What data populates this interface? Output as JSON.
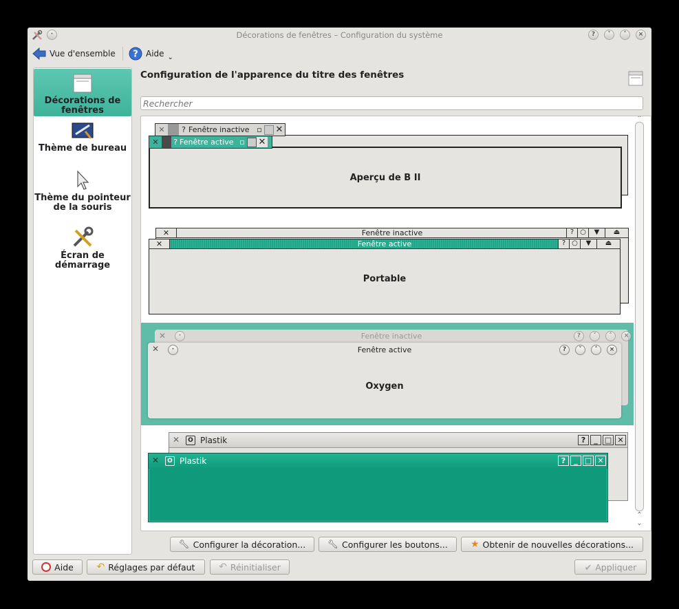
{
  "window": {
    "title": "Décorations de fenêtres – Configuration du système",
    "buttons": [
      "?",
      "v",
      "^",
      "x"
    ]
  },
  "toolbar": {
    "overview_label": "Vue d'ensemble",
    "help_label": "Aide"
  },
  "sidebar": {
    "items": [
      {
        "label": "Décorations de fenêtres",
        "icon": "window-decoration-icon",
        "active": true
      },
      {
        "label": "Thème de bureau",
        "icon": "desktop-theme-icon",
        "active": false
      },
      {
        "label": "Thème du pointeur de la souris",
        "icon": "mouse-pointer-icon",
        "active": false
      },
      {
        "label": "Écran de démarrage",
        "icon": "tools-icon",
        "active": false
      }
    ]
  },
  "main": {
    "title": "Configuration de l'apparence du titre des fenêtres",
    "search_placeholder": "Rechercher"
  },
  "decorations": [
    {
      "name": "Aperçu de B II",
      "inactive_title": "Fenêtre inactive",
      "active_title": "Fenêtre active",
      "selected": false
    },
    {
      "name": "Portable",
      "inactive_title": "Fenêtre inactive",
      "active_title": "Fenêtre active",
      "selected": false
    },
    {
      "name": "Oxygen",
      "inactive_title": "Fenêtre inactive",
      "active_title": "Fenêtre active",
      "selected": true
    },
    {
      "name": "Plastik",
      "inactive_title": "Plastik",
      "active_title": "Plastik",
      "selected": false
    }
  ],
  "action_buttons": {
    "configure_decoration": "Configurer la décoration...",
    "configure_buttons": "Configurer les boutons...",
    "get_new": "Obtenir de nouvelles décorations..."
  },
  "footer": {
    "help": "Aide",
    "defaults": "Réglages par défaut",
    "reset": "Réinitialiser",
    "apply": "Appliquer"
  },
  "colors": {
    "accent": "#3eb29a",
    "plastik_active": "#0f9a7c"
  }
}
